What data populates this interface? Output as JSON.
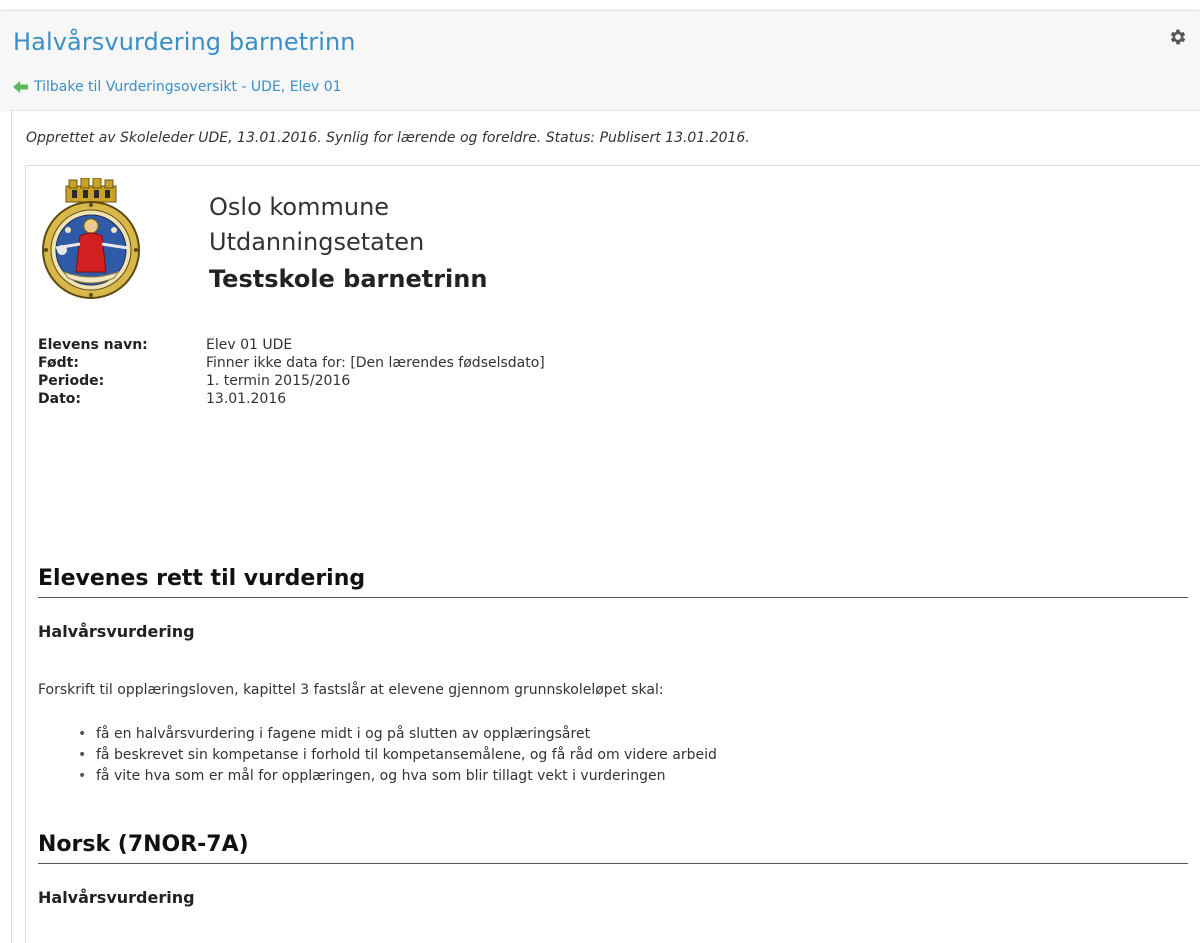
{
  "header": {
    "title": "Halvårsvurdering barnetrinn",
    "back_link": "Tilbake til Vurderingsoversikt - UDE, Elev 01",
    "icons": {
      "settings": "gear-icon",
      "back": "arrow-left-icon"
    },
    "colors": {
      "link": "#3a8fc6"
    }
  },
  "meta": {
    "line": "Opprettet av Skoleleder UDE, 13.01.2016. Synlig for lærende og foreldre. Status: Publisert 13.01.2016."
  },
  "document": {
    "org_line1": "Oslo kommune",
    "org_line2": "Utdanningsetaten",
    "school": "Testskole barnetrinn",
    "crest_icon": "oslo-coat-of-arms-icon",
    "info": [
      {
        "label": "Elevens navn:",
        "value": "Elev 01 UDE"
      },
      {
        "label": "Født:",
        "value": "Finner ikke data for: [Den lærendes fødselsdato]"
      },
      {
        "label": "Periode:",
        "value": "1. termin 2015/2016"
      },
      {
        "label": "Dato:",
        "value": "13.01.2016"
      }
    ],
    "sections": [
      {
        "heading": "Elevenes rett til vurdering",
        "subheading": "Halvårsvurdering",
        "intro": "Forskrift til opplæringsloven, kapittel 3 fastslår at elevene gjennom grunnskoleløpet skal:",
        "bullets": [
          "få en halvårsvurdering i fagene midt i og på slutten av opplæringsåret",
          "få beskrevet sin kompetanse i forhold til kompetansemålene, og få råd om videre arbeid",
          "få vite hva som er mål for opplæringen, og hva som blir tillagt vekt i vurderingen"
        ]
      },
      {
        "heading": "Norsk (7NOR-7A)",
        "subheading": "Halvårsvurdering"
      }
    ]
  }
}
